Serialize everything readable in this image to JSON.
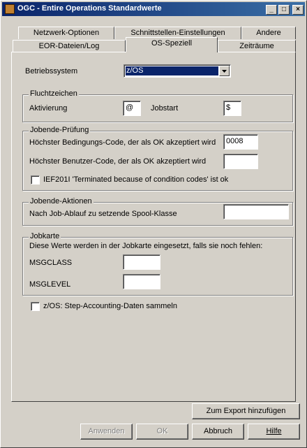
{
  "window": {
    "title": "OGC - Entire Operations Standardwerte"
  },
  "tabs_back": [
    "Netzwerk-Optionen",
    "Schnittstellen-Einstellungen",
    "Andere"
  ],
  "tabs_front": [
    "EOR-Dateien/Log",
    "OS-Speziell",
    "Zeiträume"
  ],
  "active_tab": "OS-Speziell",
  "betriebssystem": {
    "label": "Betriebssystem",
    "value": "z/OS"
  },
  "fluchtzeichen": {
    "title": "Fluchtzeichen",
    "aktivierung_label": "Aktivierung",
    "aktivierung_value": "@",
    "jobstart_label": "Jobstart",
    "jobstart_value": "$"
  },
  "jobende_pruefung": {
    "title": "Jobende-Prüfung",
    "bedingungscode_label": "Höchster Bedingungs-Code, der als OK akzeptiert wird",
    "bedingungscode_value": "0008",
    "benutzercode_label": "Höchster Benutzer-Code, der als OK akzeptiert wird",
    "benutzercode_value": "",
    "ief_label": "IEF201I 'Terminated because of condition codes' ist ok",
    "ief_checked": false
  },
  "jobende_aktionen": {
    "title": "Jobende-Aktionen",
    "spool_label": "Nach Job-Ablauf zu setzende Spool-Klasse",
    "spool_value": ""
  },
  "jobkarte": {
    "title": "Jobkarte",
    "info": "Diese Werte werden in der Jobkarte eingesetzt, falls sie noch fehlen:",
    "msgclass_label": "MSGCLASS",
    "msgclass_value": "",
    "msglevel_label": "MSGLEVEL",
    "msglevel_value": ""
  },
  "step_accounting": {
    "label": "z/OS: Step-Accounting-Daten sammeln",
    "checked": false
  },
  "buttons": {
    "export": "Zum Export hinzufügen",
    "anwenden": "Anwenden",
    "ok": "OK",
    "abbruch": "Abbruch",
    "hilfe": "Hilfe"
  }
}
